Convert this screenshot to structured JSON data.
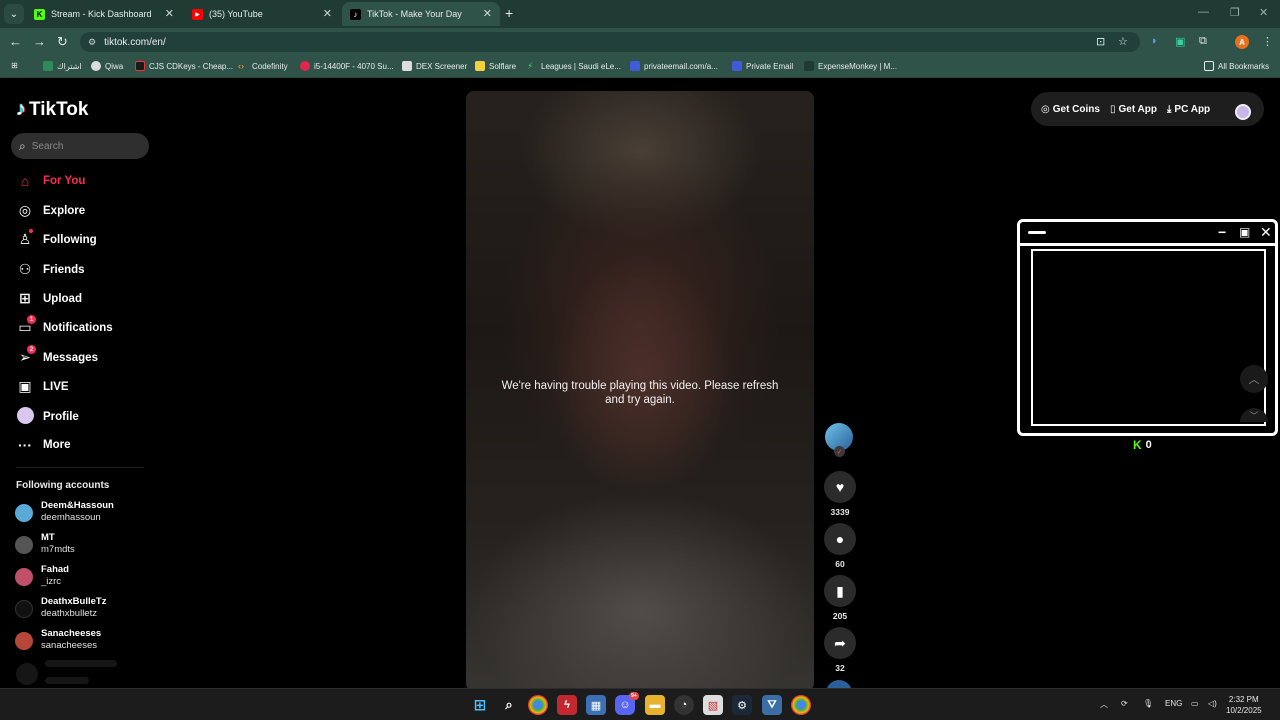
{
  "browser": {
    "tabs": [
      {
        "title": "Stream - Kick Dashboard",
        "icon": "kick-icon",
        "color": "#53fc18"
      },
      {
        "title": "(35) YouTube",
        "icon": "youtube-icon",
        "color": "#ff0000"
      },
      {
        "title": "TikTok - Make Your Day",
        "icon": "tiktok-icon",
        "color": "#000000",
        "active": true
      }
    ],
    "url": "tiktok.com/en/",
    "profile_initial": "A",
    "bookmarks": [
      {
        "label": "اشتراك"
      },
      {
        "label": "Qiwa"
      },
      {
        "label": "CJS CDKeys - Cheap..."
      },
      {
        "label": "Codefinity"
      },
      {
        "label": "i5-14400F - 4070 Su..."
      },
      {
        "label": "DEX Screener"
      },
      {
        "label": "Solflare"
      },
      {
        "label": "Leagues | Saudi eLe..."
      },
      {
        "label": "privateemail.com/a..."
      },
      {
        "label": "Private Email"
      },
      {
        "label": "ExpenseMonkey | M..."
      }
    ],
    "all_bookmarks": "All Bookmarks"
  },
  "tiktok": {
    "logo": "TikTok",
    "search_placeholder": "Search",
    "nav": [
      {
        "label": "For You",
        "icon": "home-icon"
      },
      {
        "label": "Explore",
        "icon": "compass-icon"
      },
      {
        "label": "Following",
        "icon": "following-icon"
      },
      {
        "label": "Friends",
        "icon": "friends-icon"
      },
      {
        "label": "Upload",
        "icon": "upload-icon"
      },
      {
        "label": "Notifications",
        "icon": "inbox-icon",
        "badge": "1"
      },
      {
        "label": "Messages",
        "icon": "messages-icon",
        "badge": "2"
      },
      {
        "label": "LIVE",
        "icon": "live-icon"
      },
      {
        "label": "Profile",
        "icon": "profile-icon"
      },
      {
        "label": "More",
        "icon": "more-icon"
      }
    ],
    "following_title": "Following accounts",
    "accounts": [
      {
        "name": "Deem&Hassoun",
        "user": "deemhassoun",
        "color": "#5aa9d6"
      },
      {
        "name": "MT",
        "user": "m7mdts",
        "color": "#555555"
      },
      {
        "name": "Fahad",
        "user": "_izrc",
        "color": "#c0506a"
      },
      {
        "name": "DeathxBulleTz",
        "user": "deathxbulletz",
        "color": "#111111"
      },
      {
        "name": "Sanacheeses",
        "user": "sanacheeses",
        "color": "#b5483a"
      }
    ],
    "video_error": "We're having trouble playing this video. Please refresh and try again.",
    "actions": {
      "likes": "3339",
      "comments": "60",
      "saves": "205",
      "shares": "32"
    },
    "header_actions": {
      "coins": "Get Coins",
      "app": "Get App",
      "pc": "PC App"
    },
    "kick_count": "0"
  },
  "taskbar": {
    "lang": "ENG",
    "time": "2:32 PM",
    "date": "10/2/2025",
    "discord_badge": "9+"
  }
}
